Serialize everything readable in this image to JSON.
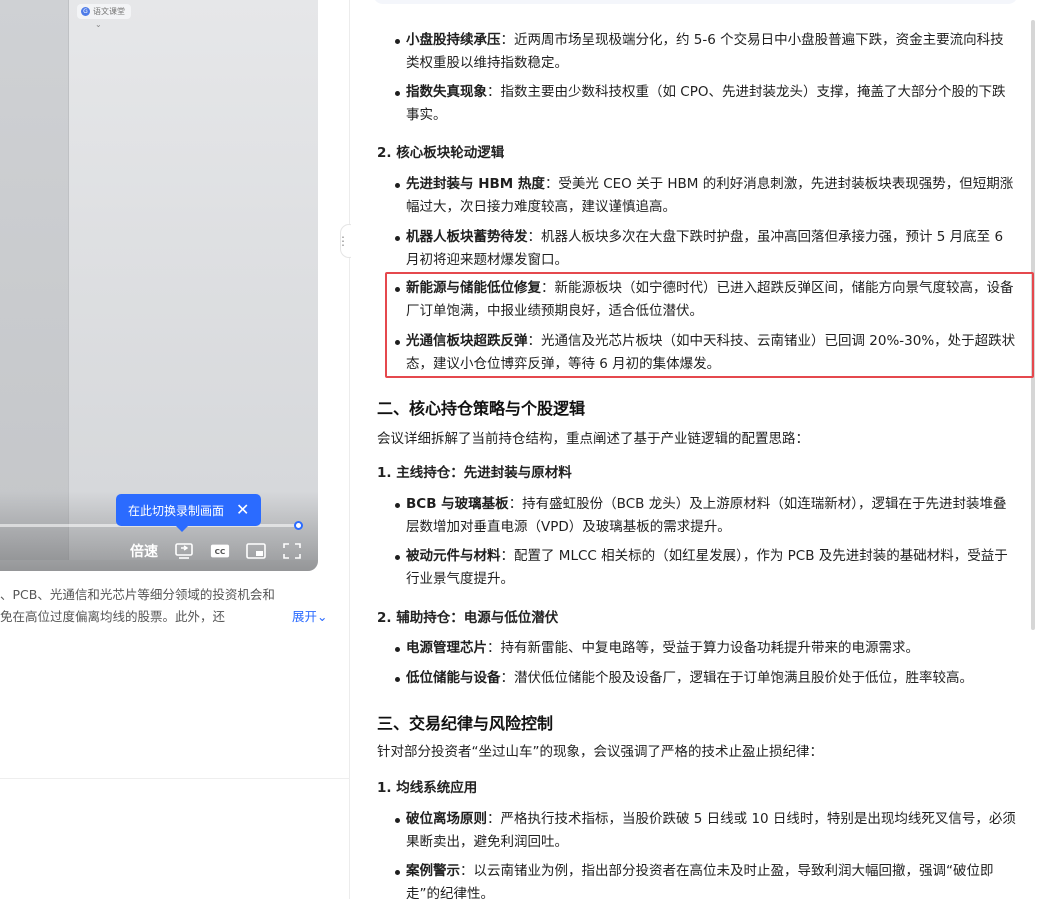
{
  "left_pane": {
    "video_pill_text": "语文课堂",
    "tooltip_text": "在此切换录制画面",
    "tooltip_close": "✕",
    "speed_label": "倍速",
    "progress_fraction": 0.94,
    "summary_lines": [
      "、PCB、光通信和光芯片等细分领域的投资机会和",
      "免在高位过度偏离均线的股票。此外，还"
    ],
    "expand_label": "展开"
  },
  "right_pane": {
    "section1": {
      "bullets_a": [
        {
          "bold": "小盘股持续承压",
          "text": "：近两周市场呈现极端分化，约 5-6 个交易日中小盘股普遍下跌，资金主要流向科技类权重股以维持指数稳定。"
        },
        {
          "bold": "指数失真现象",
          "text": "：指数主要由少数科技权重（如 CPO、先进封装龙头）支撑，掩盖了大部分个股的下跌事实。"
        }
      ],
      "subhead2": "2. 核心板块轮动逻辑",
      "bullets_b": [
        {
          "bold": "先进封装与 HBM 热度",
          "text": "：受美光 CEO 关于 HBM 的利好消息刺激，先进封装板块表现强势，但短期涨幅过大，次日接力难度较高，建议谨慎追高。"
        },
        {
          "bold": "机器人板块蓄势待发",
          "text": "：机器人板块多次在大盘下跌时护盘，虽冲高回落但承接力强，预计 5 月底至 6 月初将迎来题材爆发窗口。"
        },
        {
          "bold": "新能源与储能低位修复",
          "text": "：新能源板块（如宁德时代）已进入超跌反弹区间，储能方向景气度较高，设备厂订单饱满，中报业绩预期良好，适合低位潜伏。"
        },
        {
          "bold": "光通信板块超跌反弹",
          "text": "：光通信及光芯片板块（如中天科技、云南锗业）已回调 20%-30%，处于超跌状态，建议小仓位博弈反弹，等待 6 月初的集体爆发。"
        }
      ]
    },
    "section2": {
      "title": "二、核心持仓策略与个股逻辑",
      "intro": "会议详细拆解了当前持仓结构，重点阐述了基于产业链逻辑的配置思路：",
      "sub1": "1. 主线持仓：先进封装与原材料",
      "bullets1": [
        {
          "bold": "BCB 与玻璃基板",
          "text": "：持有盛虹股份（BCB 龙头）及上游原材料（如连瑞新材），逻辑在于先进封装堆叠层数增加对垂直电源（VPD）及玻璃基板的需求提升。"
        },
        {
          "bold": "被动元件与材料",
          "text": "：配置了 MLCC 相关标的（如红星发展），作为 PCB 及先进封装的基础材料，受益于行业景气度提升。"
        }
      ],
      "sub2": "2. 辅助持仓：电源与低位潜伏",
      "bullets2": [
        {
          "bold": "电源管理芯片",
          "text": "：持有新雷能、中复电路等，受益于算力设备功耗提升带来的电源需求。"
        },
        {
          "bold": "低位储能与设备",
          "text": "：潜伏低位储能个股及设备厂，逻辑在于订单饱满且股价处于低位，胜率较高。"
        }
      ]
    },
    "section3": {
      "title": "三、交易纪律与风险控制",
      "intro": "针对部分投资者“坐过山车”的现象，会议强调了严格的技术止盈止损纪律：",
      "sub1": "1. 均线系统应用",
      "bullets1": [
        {
          "bold": "破位离场原则",
          "text": "：严格执行技术指标，当股价跌破 5 日线或 10 日线时，特别是出现均线死叉信号，必须果断卖出，避免利润回吐。"
        },
        {
          "bold": "案例警示",
          "text": "：以云南锗业为例，指出部分投资者在高位未及时止盈，导致利润大幅回撤，强调“破位即走”的纪律性。"
        }
      ]
    }
  },
  "colors": {
    "accent": "#2b6bff",
    "highlight_border": "#e5484d"
  }
}
